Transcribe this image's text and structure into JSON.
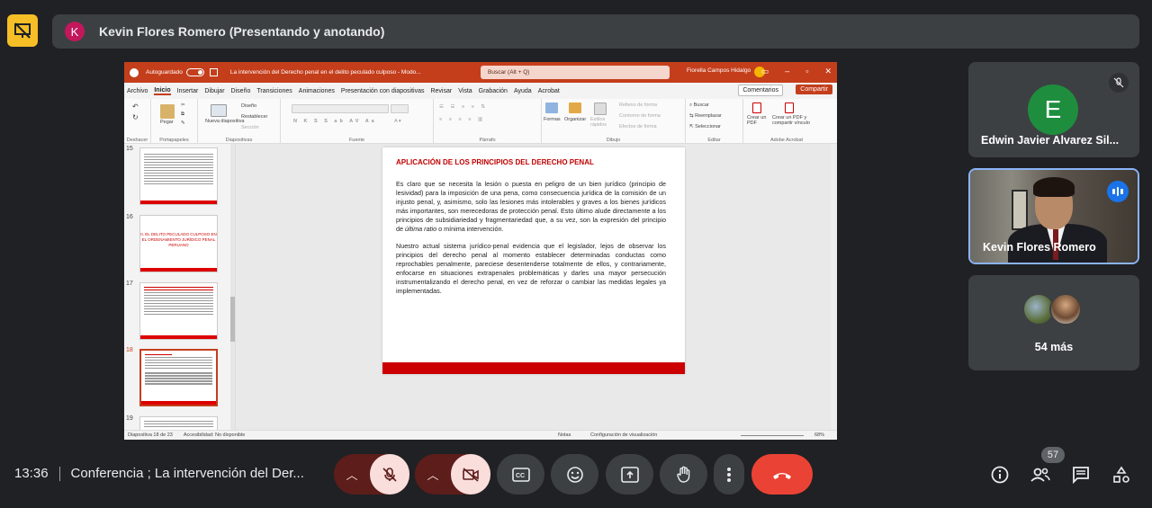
{
  "header": {
    "presenter_initial": "K",
    "presenter_label": "Kevin Flores Romero (Presentando y anotando)"
  },
  "powerpoint": {
    "autosave_label": "Autoguardado",
    "doc_title": "La intervención del Derecho penal en el delito peculado culposo - Modo...",
    "search_placeholder": "Buscar (Alt + Q)",
    "user_name": "Fiorella Campos Hidalgo",
    "menu": [
      "Archivo",
      "Inicio",
      "Insertar",
      "Dibujar",
      "Diseño",
      "Transiciones",
      "Animaciones",
      "Presentación con diapositivas",
      "Revisar",
      "Vista",
      "Grabación",
      "Ayuda",
      "Acrobat"
    ],
    "comments_label": "Comentarios",
    "share_label": "Compartir",
    "ribbon": {
      "undo_group": "Deshacer",
      "clipboard_group": "Portapapeles",
      "slides_group": "Diapositivas",
      "font_group": "Fuente",
      "paragraph_group": "Párrafo",
      "drawing_group": "Dibujo",
      "editing_group": "Editar",
      "acrobat_group": "Adobe Acrobat",
      "paste_label": "Pegar",
      "new_slide_label": "Nueva diapositiva",
      "layout_label": "Diseño",
      "reset_label": "Restablecer",
      "section_label": "Sección",
      "shapes_label": "Formas",
      "arrange_label": "Organizar",
      "styles_label": "Estilos rápidos",
      "fill_label": "Relleno de forma",
      "outline_label": "Contorno de forma",
      "effects_label": "Efectos de forma",
      "find_label": "Buscar",
      "replace_label": "Reemplazar",
      "select_label": "Seleccionar",
      "create_pdf_label": "Crear un PDF",
      "share_pdf_label": "Crear un PDF y compartir vínculo"
    },
    "thumbnails": [
      {
        "num": "15",
        "title": ""
      },
      {
        "num": "16",
        "title": "II. EL DELITO PECULADO CULPOSO EN EL ORDENAMIENTO JURÍDICO PENAL PERUANO"
      },
      {
        "num": "17",
        "title": ""
      },
      {
        "num": "18",
        "title": ""
      },
      {
        "num": "19",
        "title": ""
      }
    ],
    "slide": {
      "title": "APLICACIÓN DE LOS PRINCIPIOS DEL DERECHO PENAL",
      "para1_a": "Es claro que se necesita la lesión o puesta en peligro de un bien jurídico (principio de lesividad) para la imposición de una pena, como consecuencia jurídica de la comisión de un injusto penal, y, asimismo, solo las lesiones más intolerables y graves a los bienes jurídicos más importantes, son merecedoras de protección penal. Esto último alude directamente a los principios de subsidiariedad y fragmentariedad que, a su vez, son la expresión del principio de ",
      "para1_italic": "última ratio",
      "para1_b": " o mínima intervención.",
      "para2": "Nuestro actual sistema jurídico-penal evidencia que el legislador, lejos de observar los principios del derecho penal al momento establecer determinadas conductas como reprochables penalmente, pareciese desentenderse totalmente de ellos, y contrariamente, enfocarse en situaciones extrapenales problemáticas y darles una mayor persecución instrumentalizando el derecho penal, en vez de reforzar o cambiar las medidas legales ya implementadas."
    },
    "status": {
      "slide_count": "Diapositiva 18 de 23",
      "accessibility": "Accesibilidad: No disponible",
      "notes": "Notas",
      "display_settings": "Configuración de visualización",
      "zoom": "68%"
    }
  },
  "participants": [
    {
      "name": "Edwin Javier Alvarez Sil...",
      "initial": "E",
      "muted": true
    },
    {
      "name": "Kevin Flores Romero",
      "speaking": true
    },
    {
      "more": "54 más"
    }
  ],
  "footer": {
    "time": "13:36",
    "meeting_title": "Conferencia ; La intervención del Der...",
    "people_count": "57"
  },
  "colors": {
    "background": "#202124",
    "ppt_accent": "#c43e1c",
    "leave_red": "#ea4335",
    "speaking_blue": "#8ab4f8"
  }
}
